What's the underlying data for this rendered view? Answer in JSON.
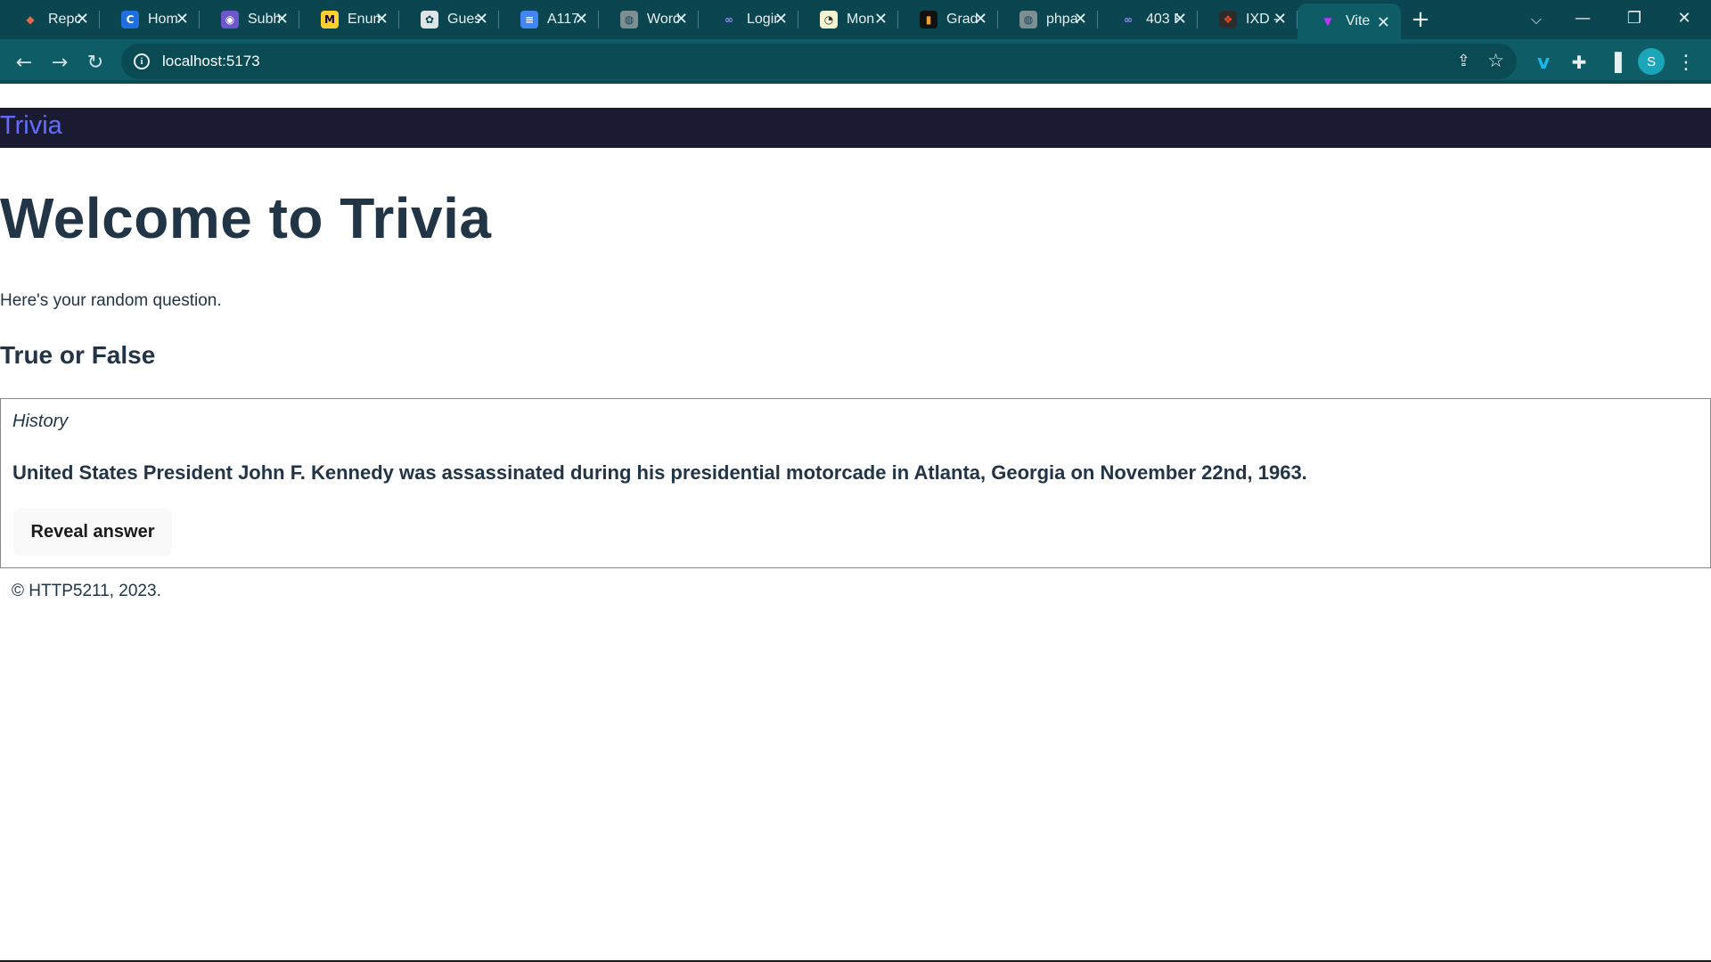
{
  "browser": {
    "tabs": [
      {
        "title": "Repo",
        "icon": "diamond-icon",
        "fav_bg": "#0b4650",
        "fav_fg": "#e06a4a",
        "glyph": "◆"
      },
      {
        "title": "Hom",
        "icon": "c-logo-icon",
        "fav_bg": "#1f6fe0",
        "fav_fg": "#ffffff",
        "glyph": "C"
      },
      {
        "title": "Subh",
        "icon": "shield-icon",
        "fav_bg": "#6e56cf",
        "fav_fg": "#ffffff",
        "glyph": "◉"
      },
      {
        "title": "Enum",
        "icon": "miro-icon",
        "fav_bg": "#ffd02f",
        "fav_fg": "#050038",
        "glyph": "M"
      },
      {
        "title": "Gues",
        "icon": "openai-icon",
        "fav_bg": "#dfe5e6",
        "fav_fg": "#0b4650",
        "glyph": "✿"
      },
      {
        "title": "A117",
        "icon": "docs-icon",
        "fav_bg": "#4285f4",
        "fav_fg": "#ffffff",
        "glyph": "≡"
      },
      {
        "title": "Word",
        "icon": "globe-icon",
        "fav_bg": "#7d8f93",
        "fav_fg": "#0b4650",
        "glyph": "◍"
      },
      {
        "title": "Login",
        "icon": "infinity-icon",
        "fav_bg": "transparent",
        "fav_fg": "#9b8cff",
        "glyph": "∞"
      },
      {
        "title": "Mon",
        "icon": "clock-icon",
        "fav_bg": "#f4f4d0",
        "fav_fg": "#333333",
        "glyph": "◔"
      },
      {
        "title": "Grad",
        "icon": "bar-chart-icon",
        "fav_bg": "#111111",
        "fav_fg": "#f0a030",
        "glyph": "▮"
      },
      {
        "title": "phpa",
        "icon": "globe-icon",
        "fav_bg": "#7d8f93",
        "fav_fg": "#0b4650",
        "glyph": "◍"
      },
      {
        "title": "403 F",
        "icon": "infinity-icon",
        "fav_bg": "transparent",
        "fav_fg": "#9b8cff",
        "glyph": "∞"
      },
      {
        "title": "IXD -",
        "icon": "figma-icon",
        "fav_bg": "#2c2c2c",
        "fav_fg": "#f24e1e",
        "glyph": "❖"
      },
      {
        "title": "Vite",
        "icon": "vite-icon",
        "fav_bg": "transparent",
        "fav_fg": "#bd34fe",
        "glyph": "▼",
        "active": true
      }
    ],
    "new_tab_label": "+",
    "url": "localhost:5173",
    "profile_initial": "S"
  },
  "app": {
    "brand": "Trivia",
    "heading": "Welcome to Trivia",
    "lead": "Here's your random question.",
    "question_type": "True or False",
    "question": {
      "category": "History",
      "text": "United States President John F. Kennedy was assassinated during his presidential motorcade in Atlanta, Georgia on November 22nd, 1963.",
      "button_label": "Reveal answer"
    },
    "footer": "© HTTP5211, 2023."
  },
  "colors": {
    "browser_frame": "#0b4650",
    "toolbar": "#0e5c66",
    "appbar": "#1a1b32",
    "brand": "#646cff",
    "text": "#213547"
  }
}
